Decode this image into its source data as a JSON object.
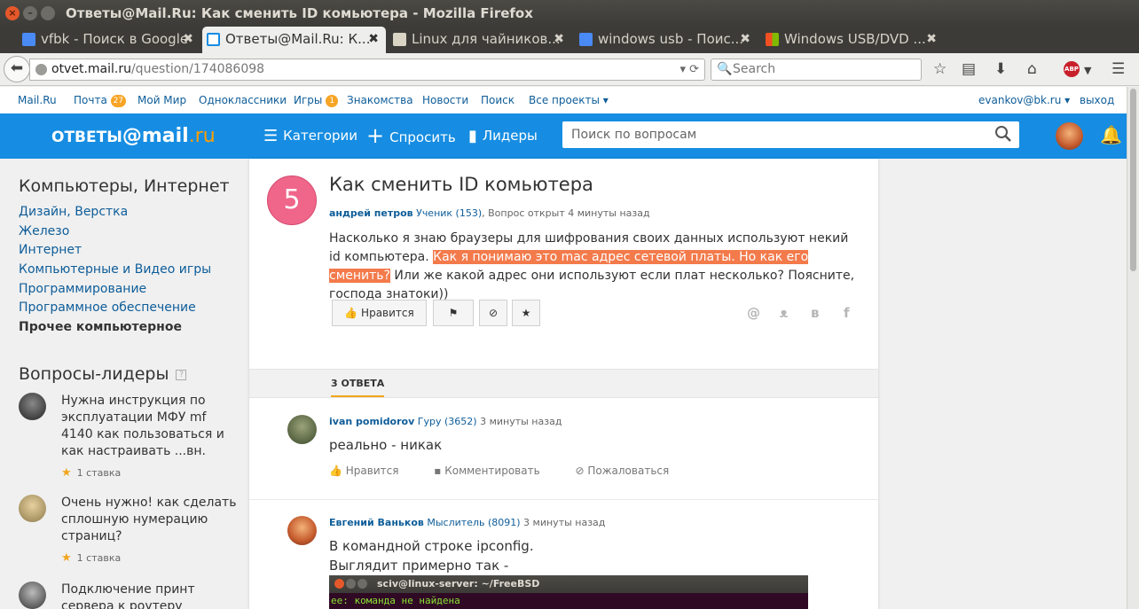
{
  "window": {
    "title": "Ответы@Mail.Ru: Как сменить ID комьютера - Mozilla Firefox"
  },
  "tabs": [
    {
      "label": "vfbk - Поиск в Google",
      "active": false
    },
    {
      "label": "Ответы@Mail.Ru: К...",
      "active": true
    },
    {
      "label": "Linux для чайников...",
      "active": false
    },
    {
      "label": "windows usb - Поис...",
      "active": false
    },
    {
      "label": "Windows USB/DVD ...",
      "active": false
    }
  ],
  "nav": {
    "url_host": "otvet.mail.ru",
    "url_prefix": "",
    "url_path": "/question/174086098",
    "search_placeholder": "Search"
  },
  "portal": {
    "links": [
      "Mail.Ru",
      "Почта",
      "Мой Мир",
      "Одноклассники",
      "Игры",
      "Знакомства",
      "Новости",
      "Поиск",
      "Все проекты"
    ],
    "mail_count": "27",
    "games_count": "1",
    "user": "evankov@bk.ru",
    "logout": "выход"
  },
  "header": {
    "logo": "ОТВЕТЫ@mail.ru",
    "logo_a": "ОТВЕТЫ",
    "logo_b": "@mail",
    "logo_c": ".ru",
    "nav": [
      "Категории",
      "Спросить",
      "Лидеры"
    ],
    "search_placeholder": "Поиск по вопросам"
  },
  "sidebar": {
    "title": "Компьютеры, Интернет",
    "categories": [
      "Дизайн, Верстка",
      "Железо",
      "Интернет",
      "Компьютерные и Видео игры",
      "Программирование",
      "Программное обеспечение",
      "Прочее компьютерное"
    ],
    "leaders_title": "Вопросы-лидеры",
    "leaders": [
      {
        "text": "Нужна инструкция по эксплуатации МФУ mf 4140 как пользоваться и как настраивать ...вн.",
        "stakes": "1 ставка"
      },
      {
        "text": "Очень нужно! как сделать сплошную нумерацию страниц?",
        "stakes": "1 ставка"
      },
      {
        "text": "Подключение принт сервера к роутеру",
        "stakes": ""
      }
    ]
  },
  "question": {
    "score": "5",
    "title": "Как сменить ID комьютера",
    "author": "андрей петров",
    "rank": "Ученик (153)",
    "status": "Вопрос открыт 4 минуты назад",
    "text_a": "Насколько я знаю браузеры для шифрования своих данных используют некий id компьютера. ",
    "text_highlight": "Как я понимаю это mac адрес сетевой платы. Но как его сменить?",
    "text_b": " Или же какой адрес они используют если плат несколько? Поясните, господа знатоки))",
    "like_label": "Нравится",
    "answers_count": "3 ОТВЕТА"
  },
  "answers": [
    {
      "author": "ivan pomidorov",
      "rank": "Гуру (3652)",
      "time": "3 минуты назад",
      "text": "реально - никак",
      "like": "Нравится",
      "comment": "Комментировать",
      "report": "Пожаловаться"
    },
    {
      "author": "Евгений Ваньков",
      "rank": "Мыслитель (8091)",
      "time": "3 минуты назад",
      "text_1": "В командной строке ipconfig.",
      "text_2": "Выглядит примерно так -",
      "terminal_title": "sciv@linux-server: ~/FreeBSD",
      "terminal_line": "ee: команда не найдена"
    }
  ]
}
